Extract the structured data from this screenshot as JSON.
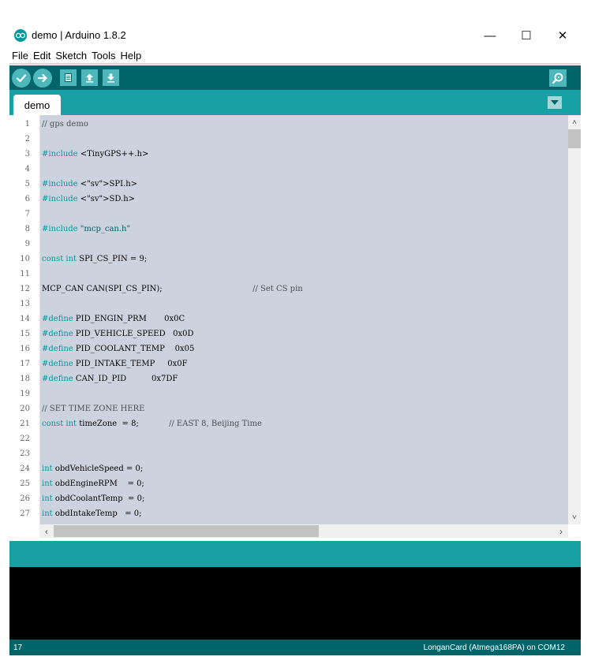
{
  "window": {
    "title": "demo | Arduino 1.8.2",
    "minimize_label": "—",
    "maximize_label": "☐",
    "close_label": "✕"
  },
  "menubar": [
    "File",
    "Edit",
    "Sketch",
    "Tools",
    "Help"
  ],
  "toolbar": {
    "icons": [
      "verify-icon",
      "upload-icon",
      "new-icon",
      "open-icon",
      "save-icon",
      "serial-monitor-icon"
    ]
  },
  "tabs": [
    {
      "label": "demo"
    }
  ],
  "editor": {
    "lines": [
      {
        "n": "1",
        "text": "// gps demo"
      },
      {
        "n": "2",
        "text": ""
      },
      {
        "n": "3",
        "text": "#include <TinyGPS++.h>"
      },
      {
        "n": "4",
        "text": ""
      },
      {
        "n": "5",
        "text": "#include <SPI.h>"
      },
      {
        "n": "6",
        "text": "#include <SD.h>"
      },
      {
        "n": "7",
        "text": ""
      },
      {
        "n": "8",
        "text": "#include \"mcp_can.h\""
      },
      {
        "n": "9",
        "text": ""
      },
      {
        "n": "10",
        "text": "const int SPI_CS_PIN = 9;"
      },
      {
        "n": "11",
        "text": ""
      },
      {
        "n": "12",
        "text": "MCP_CAN CAN(SPI_CS_PIN);                                    // Set CS pin"
      },
      {
        "n": "13",
        "text": ""
      },
      {
        "n": "14",
        "text": "#define PID_ENGIN_PRM       0x0C"
      },
      {
        "n": "15",
        "text": "#define PID_VEHICLE_SPEED   0x0D"
      },
      {
        "n": "16",
        "text": "#define PID_COOLANT_TEMP    0x05"
      },
      {
        "n": "17",
        "text": "#define PID_INTAKE_TEMP     0x0F"
      },
      {
        "n": "18",
        "text": "#define CAN_ID_PID          0x7DF"
      },
      {
        "n": "19",
        "text": ""
      },
      {
        "n": "20",
        "text": "// SET TIME ZONE HERE"
      },
      {
        "n": "21",
        "text": "const int timeZone  = 8;            // EAST 8, Beijing Time"
      },
      {
        "n": "22",
        "text": ""
      },
      {
        "n": "23",
        "text": ""
      },
      {
        "n": "24",
        "text": "int obdVehicleSpeed = 0;"
      },
      {
        "n": "25",
        "text": "int obdEngineRPM    = 0;"
      },
      {
        "n": "26",
        "text": "int obdCoolantTemp  = 0;"
      },
      {
        "n": "27",
        "text": "int obdIntakeTemp   = 0;"
      }
    ]
  },
  "scroll": {
    "up": "˄",
    "down": "˅",
    "left": "‹",
    "right": "›"
  },
  "status": {
    "line": "17",
    "board": "LonganCard (Atmega168PA) on COM12"
  },
  "colors": {
    "toolbar": "#006468",
    "tabstrip": "#17a1a5",
    "editor_bg": "#cdd3de",
    "keyword": "#00979c",
    "comment": "#434f54",
    "library": "#d35400",
    "console": "#000000"
  }
}
